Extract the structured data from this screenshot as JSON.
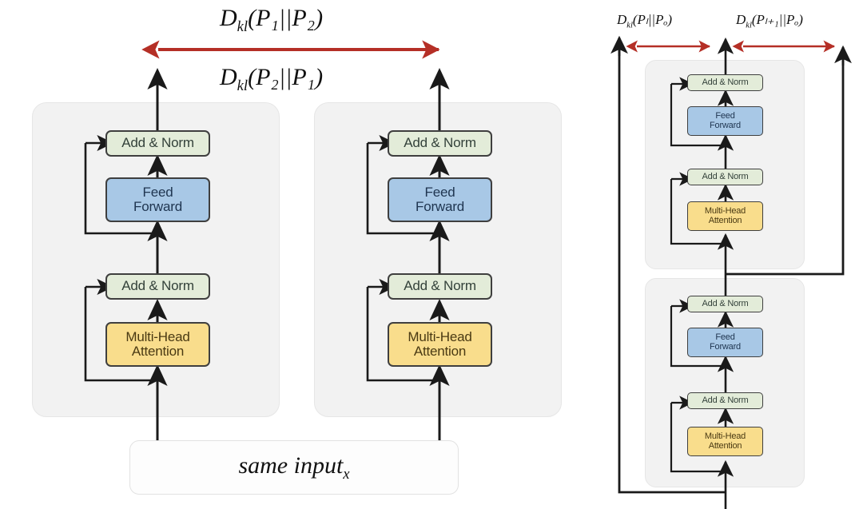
{
  "diagram": {
    "title_note": "Transformer encoder block KL-divergence comparison diagram",
    "colors": {
      "add_norm_fill": "#e3ecd9",
      "feed_forward_fill": "#a8c8e6",
      "attention_fill": "#f9dd8c",
      "panel_fill": "#f2f2f2",
      "node_border": "#3f3f3f",
      "arrow_black": "#1a1a1a",
      "arrow_red": "#b52f26"
    }
  },
  "labels": {
    "kl_p1_p2": {
      "head": "D",
      "sub": "kl",
      "args": "(P₁||P₂)",
      "full": "Dₖₗ(P₁||P₂)"
    },
    "kl_p2_p1": {
      "head": "D",
      "sub": "kl",
      "args": "(P₂||P₁)",
      "full": "Dₖₗ(P₂||P₁)"
    },
    "kl_pl_po": {
      "head": "D",
      "sub": "kl",
      "args": "(Pₗ||Pₒ)",
      "full": "Dₖₗ(Pₗ||Pₒ)"
    },
    "kl_pl1_po": {
      "head": "D",
      "sub": "kl",
      "args": "(Pₗ₊₁||Pₒ)",
      "full": "Dₖₗ(Pₗ₊₁||Pₒ)"
    }
  },
  "input_box": {
    "text": "same input",
    "subscript": "x"
  },
  "left_section": {
    "blocks": [
      {
        "name": "encoder-block-1",
        "sublayers": [
          {
            "type": "add-norm",
            "label": "Add & Norm"
          },
          {
            "type": "feed-forward",
            "label": "Feed\nForward",
            "line1": "Feed",
            "line2": "Forward"
          },
          {
            "type": "add-norm",
            "label": "Add & Norm"
          },
          {
            "type": "attention",
            "label": "Multi-Head\nAttention",
            "line1": "Multi-Head",
            "line2": "Attention"
          }
        ]
      },
      {
        "name": "encoder-block-2",
        "sublayers": [
          {
            "type": "add-norm",
            "label": "Add & Norm"
          },
          {
            "type": "feed-forward",
            "label": "Feed\nForward",
            "line1": "Feed",
            "line2": "Forward"
          },
          {
            "type": "add-norm",
            "label": "Add & Norm"
          },
          {
            "type": "attention",
            "label": "Multi-Head\nAttention",
            "line1": "Multi-Head",
            "line2": "Attention"
          }
        ]
      }
    ]
  },
  "right_section": {
    "blocks": [
      {
        "name": "layer-l-plus-1",
        "sublayers": [
          {
            "type": "add-norm",
            "label": "Add & Norm"
          },
          {
            "type": "feed-forward",
            "line1": "Feed",
            "line2": "Forward"
          },
          {
            "type": "add-norm",
            "label": "Add & Norm"
          },
          {
            "type": "attention",
            "line1": "Multi-Head",
            "line2": "Attention"
          }
        ]
      },
      {
        "name": "layer-l",
        "sublayers": [
          {
            "type": "add-norm",
            "label": "Add & Norm"
          },
          {
            "type": "feed-forward",
            "line1": "Feed",
            "line2": "Forward"
          },
          {
            "type": "add-norm",
            "label": "Add & Norm"
          },
          {
            "type": "attention",
            "line1": "Multi-Head",
            "line2": "Attention"
          }
        ]
      }
    ]
  }
}
